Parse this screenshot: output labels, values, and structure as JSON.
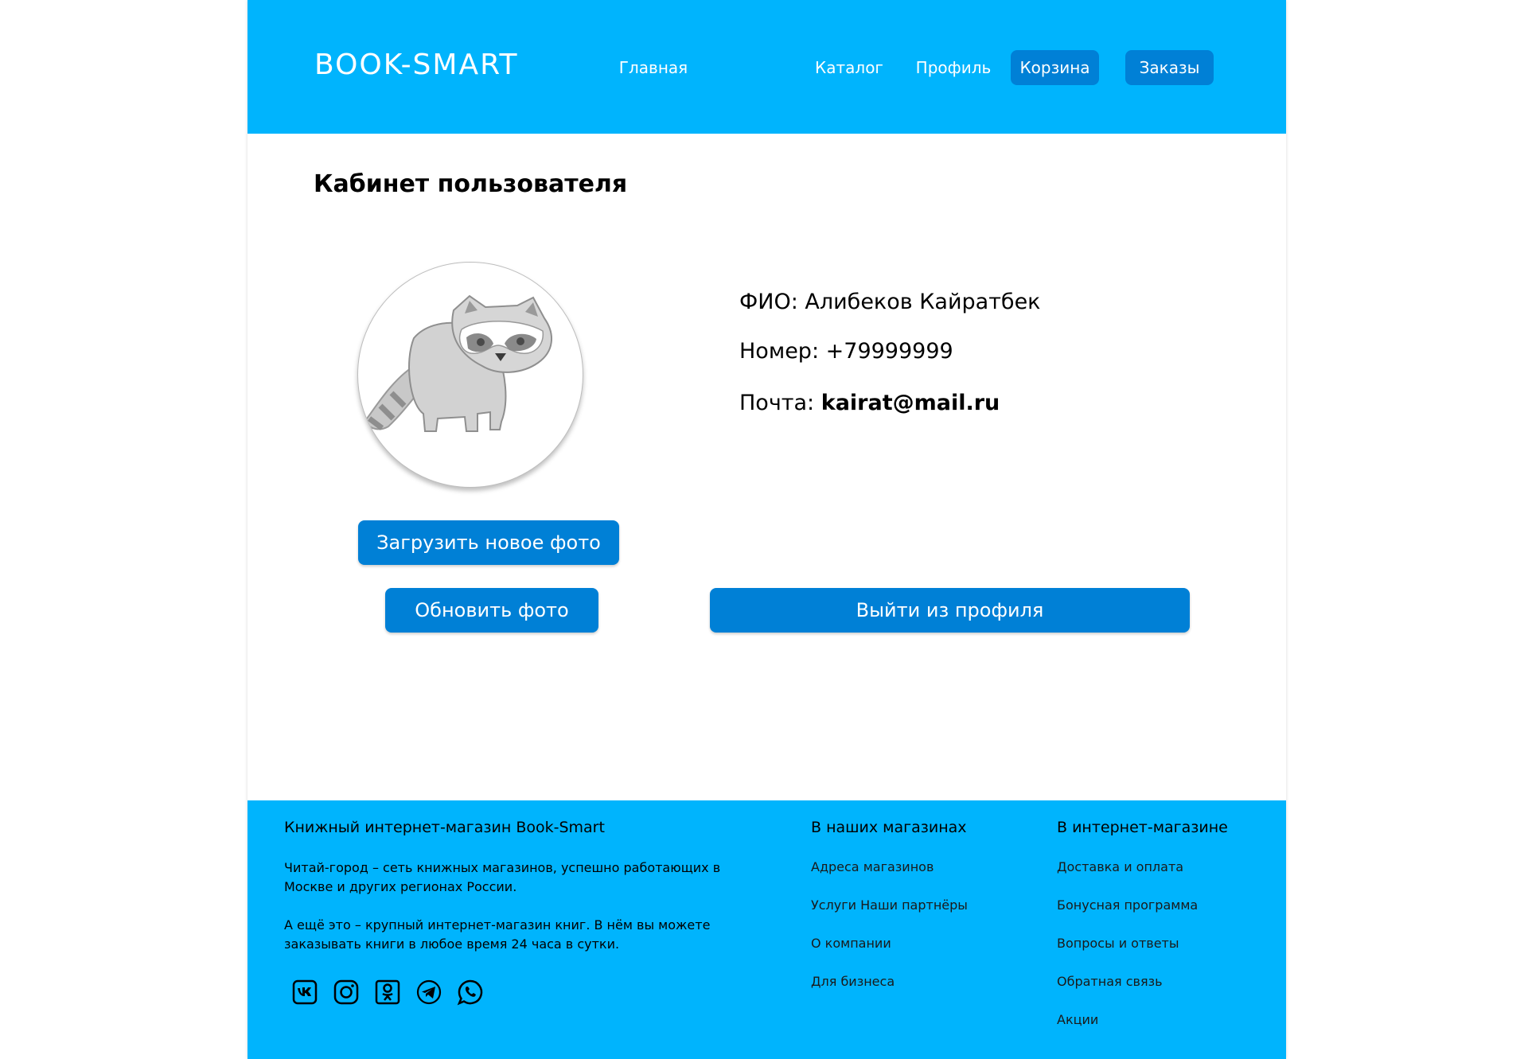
{
  "header": {
    "logo": "BOOK-SMART",
    "nav": [
      {
        "label": "Главная",
        "boxed": false
      },
      {
        "label": "Каталог",
        "boxed": false
      },
      {
        "label": "Профиль",
        "boxed": false
      },
      {
        "label": "Корзина",
        "boxed": true
      },
      {
        "label": "Заказы",
        "boxed": true
      }
    ]
  },
  "profile": {
    "title": "Кабинет пользователя",
    "fio_label": "ФИО:",
    "fio_value": "Алибеков Кайратбек",
    "phone_label": "Номер:",
    "phone_value": "+79999999",
    "email_label": "Почта:",
    "email_value": "kairat@mail.ru",
    "upload_button": "Загрузить новое фото",
    "update_button": "Обновить фото",
    "logout_button": "Выйти из профиля"
  },
  "footer": {
    "about_title": "Книжный интернет-магазин Book-Smart",
    "about_text_1": "Читай-город – сеть книжных магазинов, успешно работающих в Москве и других регионах России.",
    "about_text_2": "А ещё это – крупный интернет-магазин книг. В нём вы можете заказывать книги в любое время 24 часа в сутки.",
    "stores_title": "В наших магазинах",
    "stores_links": [
      "Адреса магазинов",
      " Услуги Наши партнёры",
      "О компании",
      "Для бизнеса"
    ],
    "online_title": "В интернет-магазине",
    "online_links": [
      "Доставка и оплата",
      "Бонусная программа",
      "Вопросы и ответы",
      "Обратная связь",
      "Акции"
    ],
    "social_icons": [
      "vk-icon",
      "instagram-icon",
      "odnoklassniki-icon",
      "telegram-icon",
      "whatsapp-icon"
    ]
  },
  "colors": {
    "header_bg": "#00b4fd",
    "button_bg": "#0080d6",
    "footer_bg": "#00b4fd"
  }
}
